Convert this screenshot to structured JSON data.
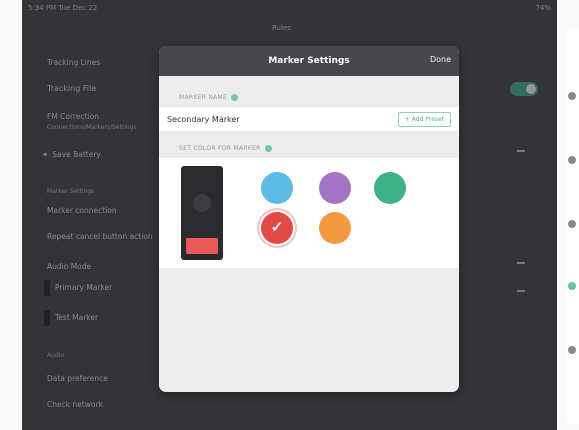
{
  "status_bar": {
    "time_date": "5:34 PM  Tue Dec 22",
    "battery": "74%"
  },
  "page_title": "Rules",
  "modal": {
    "title": "Marker Settings",
    "done_label": "Done",
    "name_section_label": "MARKER NAME",
    "marker_name_value": "Secondary Marker",
    "add_button_label": "+ Add Preset",
    "color_section_label": "SET COLOR FOR MARKER",
    "colors": [
      {
        "name": "blue",
        "hex": "#5bbbe6",
        "selected": false
      },
      {
        "name": "purple",
        "hex": "#a473c6",
        "selected": false
      },
      {
        "name": "green",
        "hex": "#3fb186",
        "selected": false
      },
      {
        "name": "red",
        "hex": "#e14a48",
        "selected": true
      },
      {
        "name": "orange",
        "hex": "#f29a3f",
        "selected": false
      }
    ],
    "preview_accent": "#e85a58"
  },
  "background_list": {
    "items": [
      "Tracking Lines",
      "Tracking File",
      "FM Correction",
      "Connections/Markers/Settings",
      "Save Battery",
      "Marker Settings",
      "Marker connection",
      "Repeat cancel button action",
      "Audio Mode",
      "Primary Marker",
      "Test Marker",
      "Audio",
      "Data preference",
      "Check network"
    ]
  }
}
